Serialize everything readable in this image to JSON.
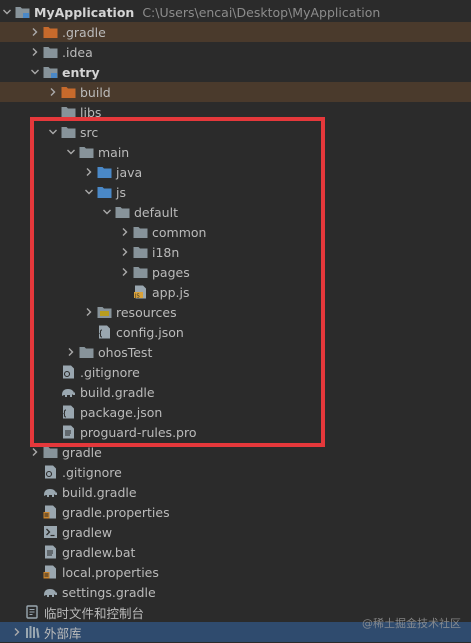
{
  "tree": {
    "root": {
      "label": "MyApplication",
      "path": "C:\\Users\\encai\\Desktop\\MyApplication"
    },
    "rows": [
      {
        "label": ".gradle",
        "indent": 1,
        "arrow": "collapsed",
        "icon": "folder-orange-icon",
        "hl": true
      },
      {
        "label": ".idea",
        "indent": 1,
        "arrow": "collapsed",
        "icon": "folder-icon"
      },
      {
        "label": "entry",
        "indent": 1,
        "arrow": "expanded",
        "icon": "module-folder-icon",
        "bold": true
      },
      {
        "label": "build",
        "indent": 2,
        "arrow": "collapsed",
        "icon": "folder-orange-icon",
        "hl": true
      },
      {
        "label": "libs",
        "indent": 2,
        "arrow": "none",
        "icon": "folder-icon"
      },
      {
        "label": "src",
        "indent": 2,
        "arrow": "expanded",
        "icon": "folder-icon"
      },
      {
        "label": "main",
        "indent": 3,
        "arrow": "expanded",
        "icon": "folder-icon"
      },
      {
        "label": "java",
        "indent": 4,
        "arrow": "collapsed",
        "icon": "folder-blue-icon"
      },
      {
        "label": "js",
        "indent": 4,
        "arrow": "expanded",
        "icon": "folder-blue-icon"
      },
      {
        "label": "default",
        "indent": 5,
        "arrow": "expanded",
        "icon": "folder-icon"
      },
      {
        "label": "common",
        "indent": 6,
        "arrow": "collapsed",
        "icon": "folder-icon"
      },
      {
        "label": "i18n",
        "indent": 6,
        "arrow": "collapsed",
        "icon": "folder-icon"
      },
      {
        "label": "pages",
        "indent": 6,
        "arrow": "collapsed",
        "icon": "folder-icon"
      },
      {
        "label": "app.js",
        "indent": 6,
        "arrow": "none",
        "icon": "js-file-icon"
      },
      {
        "label": "resources",
        "indent": 4,
        "arrow": "collapsed",
        "icon": "resources-folder-icon"
      },
      {
        "label": "config.json",
        "indent": 4,
        "arrow": "none",
        "icon": "json-file-icon"
      },
      {
        "label": "ohosTest",
        "indent": 3,
        "arrow": "collapsed",
        "icon": "folder-icon"
      },
      {
        "label": ".gitignore",
        "indent": 2,
        "arrow": "none",
        "icon": "gitignore-file-icon"
      },
      {
        "label": "build.gradle",
        "indent": 2,
        "arrow": "none",
        "icon": "gradle-elephant-icon"
      },
      {
        "label": "package.json",
        "indent": 2,
        "arrow": "none",
        "icon": "json-file-icon"
      },
      {
        "label": "proguard-rules.pro",
        "indent": 2,
        "arrow": "none",
        "icon": "text-file-icon"
      },
      {
        "label": "gradle",
        "indent": 1,
        "arrow": "collapsed",
        "icon": "folder-icon"
      },
      {
        "label": ".gitignore",
        "indent": 1,
        "arrow": "none",
        "icon": "gitignore-file-icon"
      },
      {
        "label": "build.gradle",
        "indent": 1,
        "arrow": "none",
        "icon": "gradle-elephant-icon"
      },
      {
        "label": "gradle.properties",
        "indent": 1,
        "arrow": "none",
        "icon": "properties-file-icon"
      },
      {
        "label": "gradlew",
        "indent": 1,
        "arrow": "none",
        "icon": "shell-file-icon"
      },
      {
        "label": "gradlew.bat",
        "indent": 1,
        "arrow": "none",
        "icon": "text-file-icon"
      },
      {
        "label": "local.properties",
        "indent": 1,
        "arrow": "none",
        "icon": "properties-file-icon"
      },
      {
        "label": "settings.gradle",
        "indent": 1,
        "arrow": "none",
        "icon": "gradle-elephant-icon"
      },
      {
        "label": "临时文件和控制台",
        "indent": 0,
        "arrow": "none",
        "icon": "scratches-icon"
      },
      {
        "label": "外部库",
        "indent": 0,
        "arrow": "collapsed",
        "icon": "library-icon",
        "sel": true
      }
    ]
  },
  "watermark": "@稀土掘金技术社区"
}
